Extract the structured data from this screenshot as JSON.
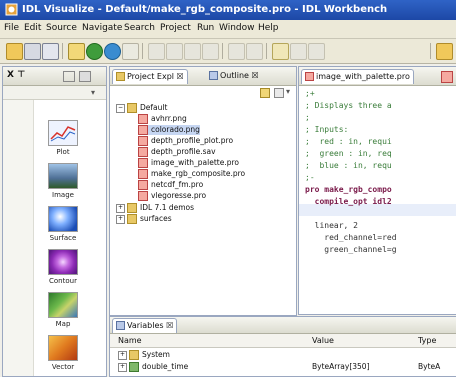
{
  "window": {
    "title": "IDL Visualize - Default/make_rgb_composite.pro - IDL Workbench"
  },
  "menu": [
    "File",
    "Edit",
    "Source",
    "Navigate",
    "Search",
    "Project",
    "Run",
    "Window",
    "Help"
  ],
  "palette": {
    "tab_label": "X ⊤",
    "items": [
      {
        "label": "Plot",
        "icon": "plot-icon",
        "color": "#e9f0ff"
      },
      {
        "label": "Image",
        "icon": "image-icon",
        "color": "#6b8fb5"
      },
      {
        "label": "Surface",
        "icon": "surface-icon",
        "color": "#3f7fd6"
      },
      {
        "label": "Contour",
        "icon": "contour-icon",
        "color": "#b14bd1"
      },
      {
        "label": "Map",
        "icon": "map-icon",
        "color": "#3e8a39"
      },
      {
        "label": "Vector",
        "icon": "vector-icon",
        "color": "#d97a20"
      }
    ]
  },
  "project_explorer": {
    "tab_label": "Project Expl ☒",
    "outline_tab": "Outline ☒",
    "root": "Default",
    "files": [
      "avhrr.png",
      "colorado.png",
      "depth_profile_plot.pro",
      "depth_profile.sav",
      "image_with_palette.pro",
      "make_rgb_composite.pro",
      "netcdf_fm.pro",
      "vlegoresse.pro"
    ],
    "others": [
      "IDL 7.1 demos",
      "surfaces"
    ]
  },
  "editor": {
    "tab_label": "image_with_palette.pro",
    "lines": [
      {
        "text": ";+",
        "kind": "comment"
      },
      {
        "text": "; Displays three a",
        "kind": "comment"
      },
      {
        "text": ";",
        "kind": "comment"
      },
      {
        "text": "; Inputs:",
        "kind": "comment"
      },
      {
        "text": ";  red : in, requi",
        "kind": "comment"
      },
      {
        "text": ";  green : in, req",
        "kind": "comment"
      },
      {
        "text": ";  blue : in, requ",
        "kind": "comment"
      },
      {
        "text": ";-",
        "kind": "comment"
      },
      {
        "text": "pro make_rgb_compo",
        "kind": "kw"
      },
      {
        "text": "  compile_opt idl2",
        "kind": "kw"
      },
      {
        "text": "",
        "kind": "plain"
      },
      {
        "text": "  linear, 2",
        "kind": "plain"
      },
      {
        "text": "    red_channel=red",
        "kind": "plain"
      },
      {
        "text": "    green_channel=g",
        "kind": "plain"
      }
    ]
  },
  "variables": {
    "tab_label": "Variables ☒",
    "columns": [
      "Name",
      "Value",
      "Type"
    ],
    "rows": [
      {
        "name": "System",
        "value": "",
        "type": ""
      },
      {
        "name": "double_time",
        "value": "ByteArray[350]",
        "type": "ByteA"
      }
    ]
  }
}
